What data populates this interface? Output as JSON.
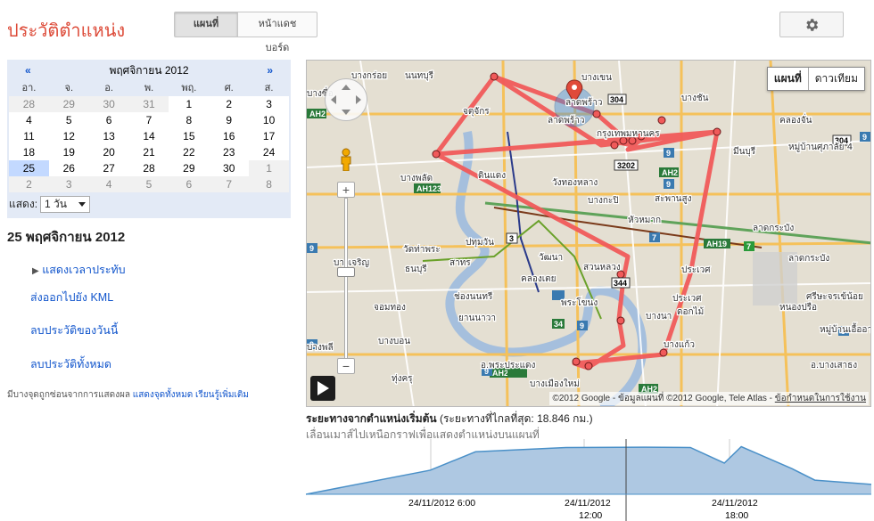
{
  "app": {
    "title": "ประวัติตำแหน่ง"
  },
  "view_toggle": {
    "map_label": "แผนที่",
    "dashboard_label": "หน้าแดชบอร์ด",
    "active": "map"
  },
  "settings": {
    "icon": "gear-icon"
  },
  "calendar": {
    "prev": "«",
    "next": "»",
    "month_label": "พฤศจิกายน 2012",
    "weekdays": [
      "อา.",
      "จ.",
      "อ.",
      "พ.",
      "พฤ.",
      "ศ.",
      "ส."
    ],
    "weeks": [
      [
        {
          "d": "28",
          "m": true
        },
        {
          "d": "29",
          "m": true
        },
        {
          "d": "30",
          "m": true
        },
        {
          "d": "31",
          "m": true
        },
        {
          "d": "1"
        },
        {
          "d": "2"
        },
        {
          "d": "3"
        }
      ],
      [
        {
          "d": "4"
        },
        {
          "d": "5"
        },
        {
          "d": "6"
        },
        {
          "d": "7"
        },
        {
          "d": "8"
        },
        {
          "d": "9"
        },
        {
          "d": "10"
        }
      ],
      [
        {
          "d": "11"
        },
        {
          "d": "12"
        },
        {
          "d": "13"
        },
        {
          "d": "14"
        },
        {
          "d": "15"
        },
        {
          "d": "16"
        },
        {
          "d": "17"
        }
      ],
      [
        {
          "d": "18"
        },
        {
          "d": "19"
        },
        {
          "d": "20"
        },
        {
          "d": "21"
        },
        {
          "d": "22"
        },
        {
          "d": "23"
        },
        {
          "d": "24"
        }
      ],
      [
        {
          "d": "25",
          "sel": true
        },
        {
          "d": "26"
        },
        {
          "d": "27"
        },
        {
          "d": "28"
        },
        {
          "d": "29"
        },
        {
          "d": "30"
        },
        {
          "d": "1",
          "m": true
        }
      ],
      [
        {
          "d": "2",
          "m": true
        },
        {
          "d": "3",
          "m": true
        },
        {
          "d": "4",
          "m": true
        },
        {
          "d": "5",
          "m": true
        },
        {
          "d": "6",
          "m": true
        },
        {
          "d": "7",
          "m": true
        },
        {
          "d": "8",
          "m": true
        }
      ]
    ],
    "show_label": "แสดง:",
    "show_value": "1 วัน"
  },
  "selected_date": "25 พฤศจิกายน 2012",
  "sidebar_links": {
    "show_times": "แสดงเวลาประทับ",
    "export_kml": "ส่งออกไปยัง KML",
    "delete_day": "ลบประวัติของวันนี้",
    "delete_all": "ลบประวัติทั้งหมด"
  },
  "hidden_note": {
    "text": "มีบางจุดถูกซ่อนจากการแสดงผล",
    "show_all": "แสดงจุดทั้งหมด",
    "learn_more": "เรียนรู้เพิ่มเติม"
  },
  "map": {
    "type_map": "แผนที่",
    "type_satellite": "ดาวเทียม",
    "attribution": "©2012 Google - ข้อมูลแผนที่ ©2012 Google, Tele Atlas -",
    "terms": "ข้อกำหนดในการใช้งาน",
    "labels": [
      "บางกร่อย",
      "นนทบุรี",
      "บางซื่อ",
      "บางเขน",
      "บางชัน",
      "คันนายาว",
      "จตุจักร",
      "ลาดพร้าว",
      "ลาดพร้าว",
      "กรุงเทพมหานคร",
      "มีนบุรี",
      "หมู่บ้านศุภาลัย 4",
      "คลองจั่น",
      "บางพลัด",
      "ดินแดง",
      "วังทองหลาง",
      "บางกะปิ",
      "สะพานสูง",
      "ปทุมวัน",
      "หัวหมาก",
      "ลาดกระบัง",
      "วัดท่าพระ",
      "บางเจริญ",
      "สาทร",
      "วัฒนา",
      "สวนหลวง",
      "ประเวศ",
      "ลาดกระบัง",
      "ธนบุรี",
      "คลองเตย",
      "หนองปรือ",
      "ช่องนนทรี",
      "พระโขนง",
      "ประเวศ",
      "จอมทอง",
      "ยานนาวา",
      "บางนา",
      "ดอกไม้",
      "ศรีษะจรเข้น้อย",
      "บางบอน",
      "บางพลี",
      "ทุ่งครุ",
      "อ.พระประแดง",
      "บางแก้ว",
      "บางเมืองใหม่",
      "อ.บางเสาธง",
      "หมู่บ้านเอื้ออาทร"
    ],
    "route_color": "#f05a5a"
  },
  "graph": {
    "title": "ระยะทางจากตำแหน่งเริ่มต้น",
    "distance": "(ระยะทางที่ไกลที่สุด: 18.846 กม.)",
    "subtitle": "เลื่อนเมาส์ไปเหนือกราฟเพื่อแสดงตำแหน่งบนแผนที่",
    "ticks": [
      {
        "date": "24/11/2012 6:00",
        "time": ""
      },
      {
        "date": "24/11/2012",
        "time": "12:00"
      },
      {
        "date": "24/11/2012",
        "time": "18:00"
      }
    ]
  },
  "chart_data": {
    "type": "area",
    "title": "ระยะทางจากตำแหน่งเริ่มต้น",
    "x": [
      "24/11/2012 0:00",
      "24/11/2012 6:00",
      "24/11/2012 9:00",
      "24/11/2012 12:00",
      "24/11/2012 14:00",
      "24/11/2012 16:00",
      "24/11/2012 17:00",
      "24/11/2012 18:00",
      "24/11/2012 20:00",
      "24/11/2012 22:00",
      "24/11/2012 24:00"
    ],
    "series": [
      {
        "values": [
          0.0,
          8.5,
          15.0,
          16.5,
          16.6,
          16.5,
          11.0,
          16.8,
          9.0,
          5.0,
          3.5
        ]
      }
    ],
    "ylim": [
      0,
      18.846
    ],
    "color": "#aec8e2",
    "line_color": "#4a90c8"
  }
}
